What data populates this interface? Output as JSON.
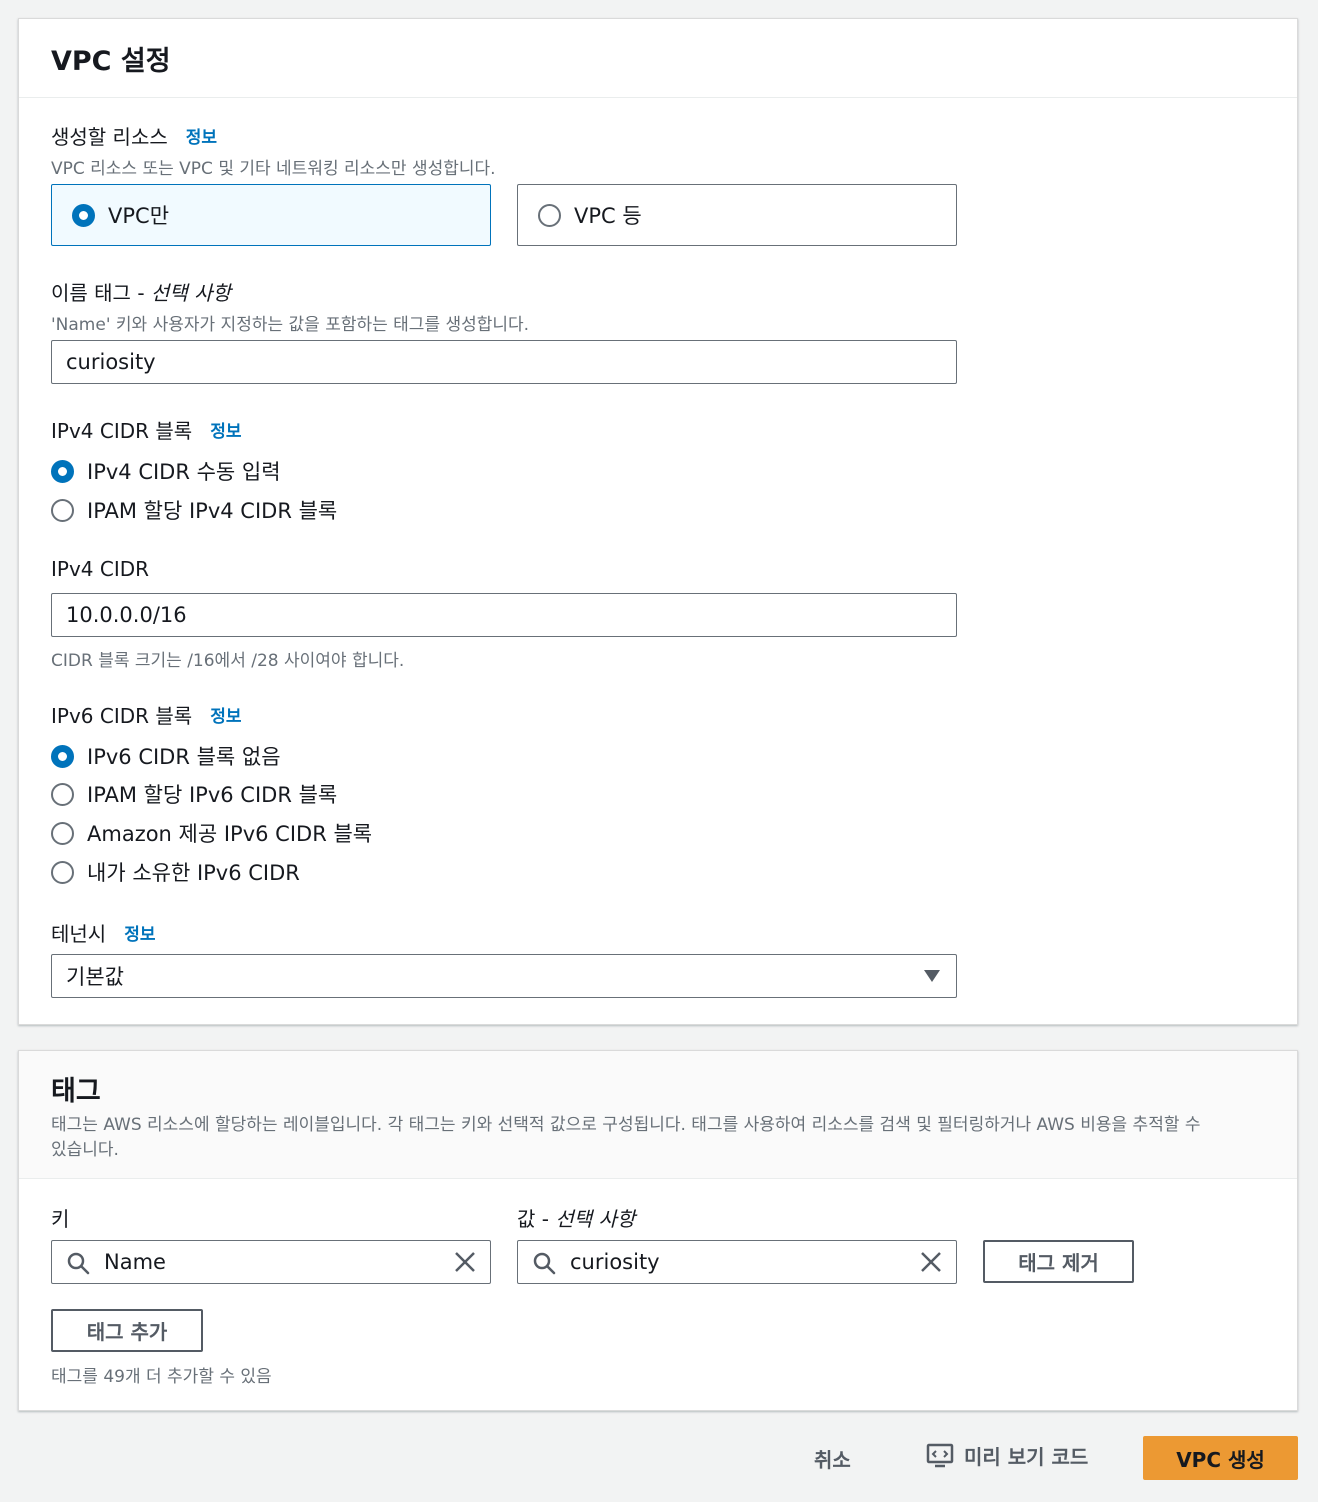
{
  "vpc_settings": {
    "title": "VPC 설정",
    "resources": {
      "label": "생성할 리소스",
      "info": "정보",
      "description": "VPC 리소스 또는 VPC 및 기타 네트워킹 리소스만 생성합니다.",
      "options": [
        "VPC만",
        "VPC 등"
      ],
      "selected_index": 0
    },
    "name_tag": {
      "label": "이름 태그 -",
      "optional": "선택 사항",
      "description": "'Name' 키와 사용자가 지정하는 값을 포함하는 태그를 생성합니다.",
      "value": "curiosity"
    },
    "ipv4_block": {
      "label": "IPv4 CIDR 블록",
      "info": "정보",
      "options": [
        "IPv4 CIDR 수동 입력",
        "IPAM 할당 IPv4 CIDR 블록"
      ],
      "selected_index": 0
    },
    "ipv4_cidr": {
      "label": "IPv4 CIDR",
      "value": "10.0.0.0/16",
      "hint": "CIDR 블록 크기는 /16에서 /28 사이여야 합니다."
    },
    "ipv6_block": {
      "label": "IPv6 CIDR 블록",
      "info": "정보",
      "options": [
        "IPv6 CIDR 블록 없음",
        "IPAM 할당 IPv6 CIDR 블록",
        "Amazon 제공 IPv6 CIDR 블록",
        "내가 소유한 IPv6 CIDR"
      ],
      "selected_index": 0
    },
    "tenancy": {
      "label": "테넌시",
      "info": "정보",
      "value": "기본값"
    }
  },
  "tags": {
    "title": "태그",
    "description_line1": "태그는 AWS 리소스에 할당하는 레이블입니다. 각 태그는 키와 선택적 값으로 구성됩니다. 태그를 사용하여 리소스를 검색 및 필터링하거나 AWS 비용을 추적할 수",
    "description_line2": "있습니다.",
    "key_label": "키",
    "value_label": "값 -",
    "value_optional": "선택 사항",
    "key_value": "Name",
    "value_value": "curiosity",
    "remove_button": "태그 제거",
    "add_button": "태그 추가",
    "remaining": "태그를 49개 더 추가할 수 있음"
  },
  "footer": {
    "cancel": "취소",
    "preview": "미리 보기 코드",
    "create": "VPC 생성"
  },
  "colors": {
    "accent": "#0073bb",
    "primary_button": "#ec9933"
  }
}
